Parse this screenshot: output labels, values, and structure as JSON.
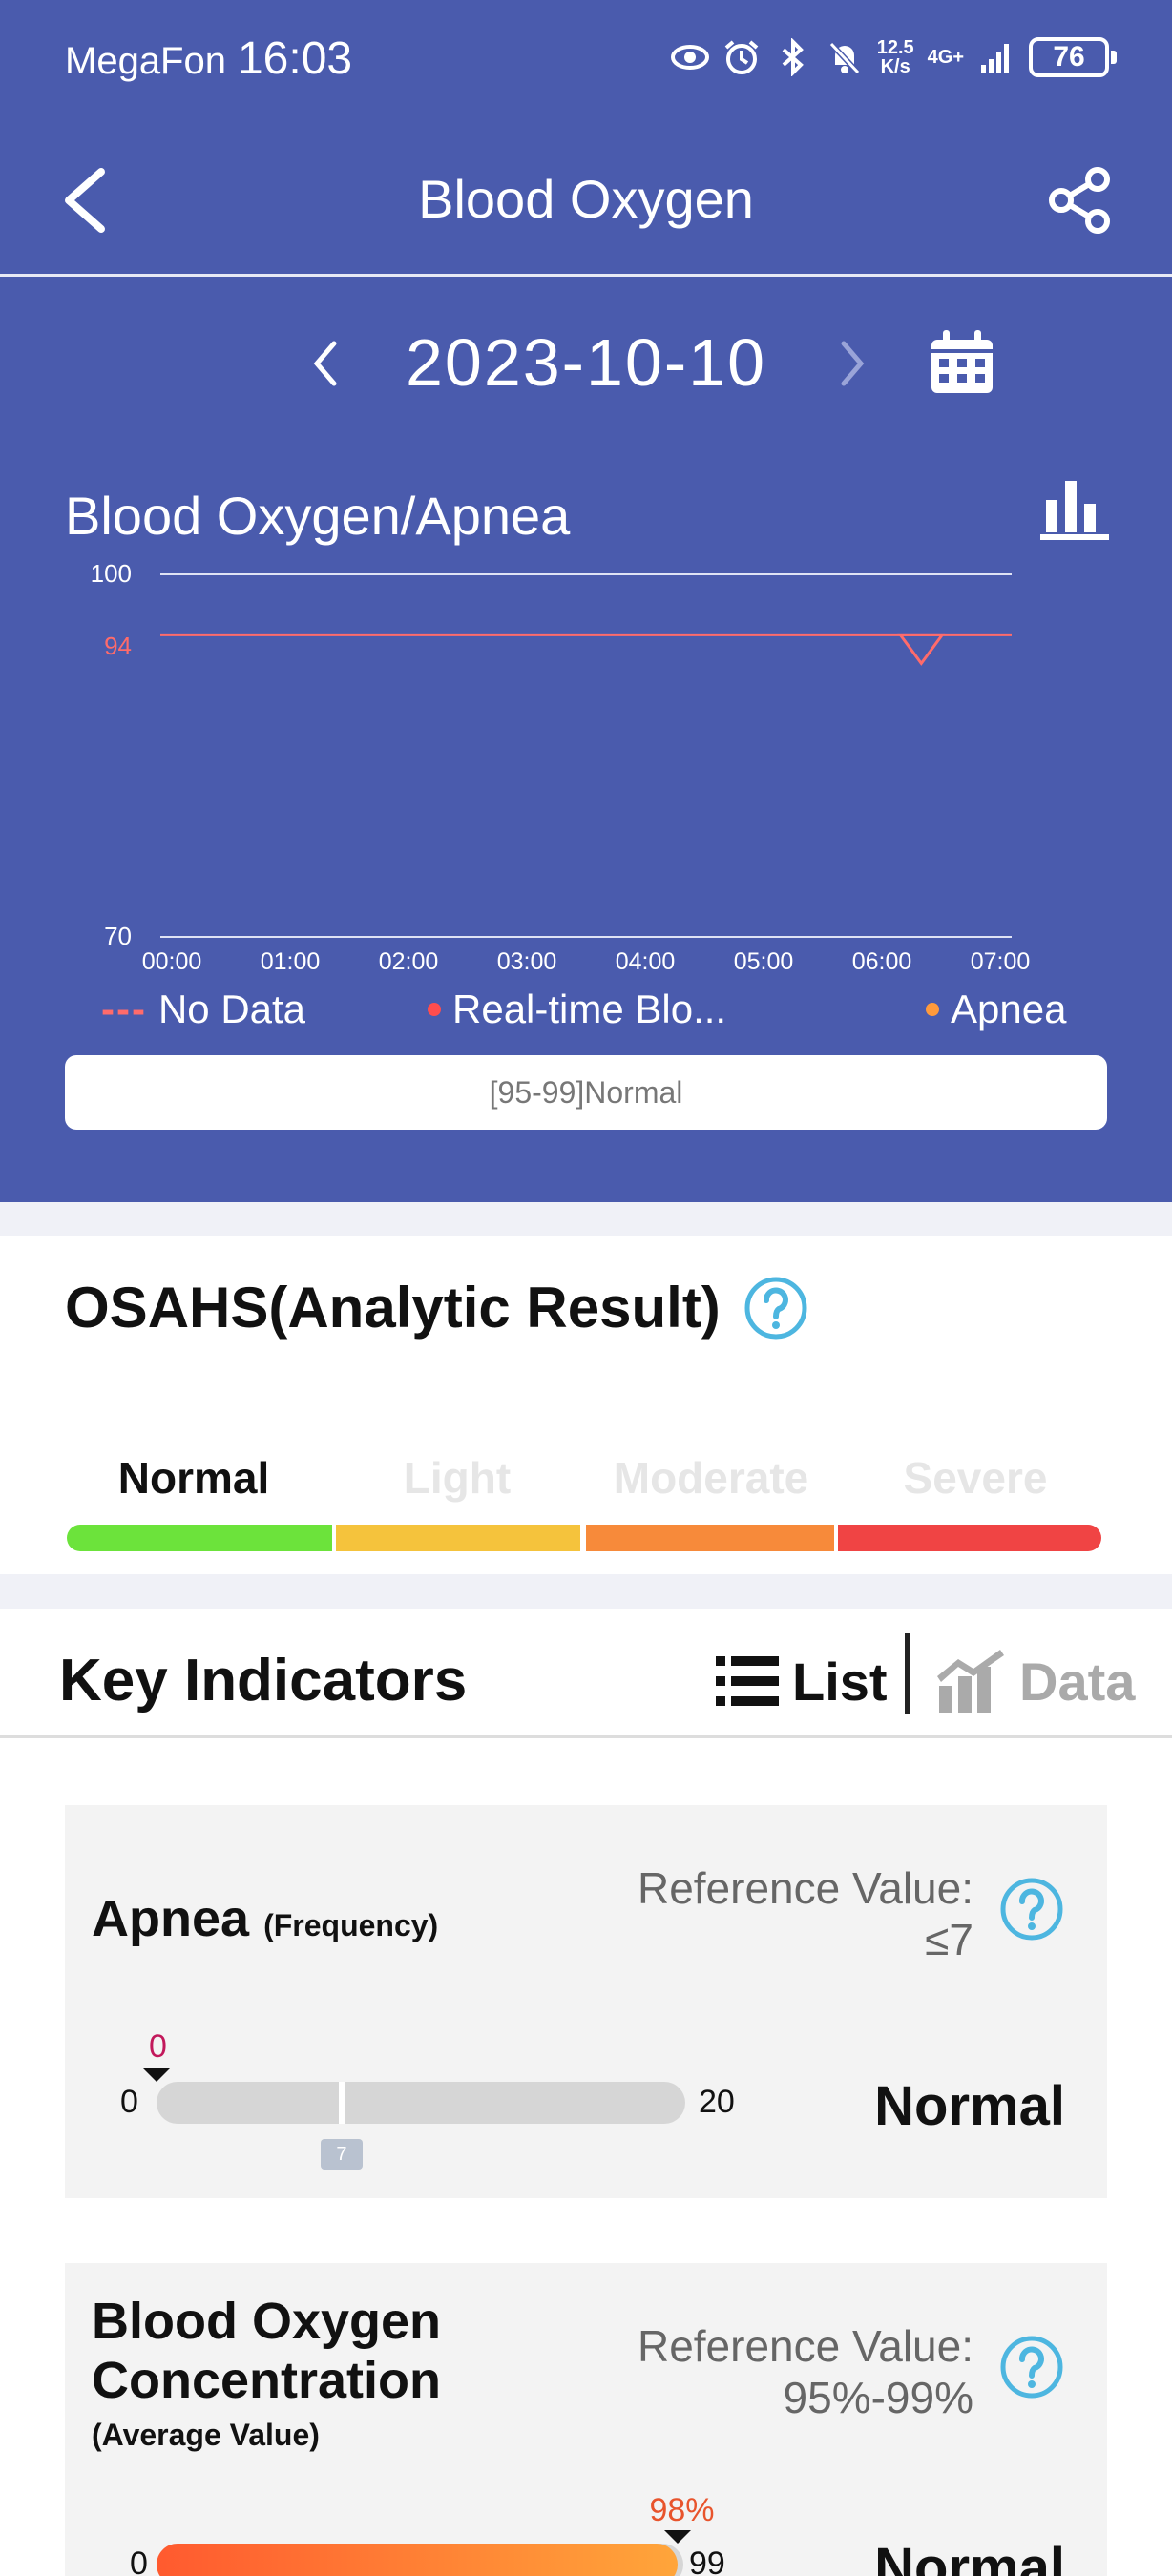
{
  "status_bar": {
    "carrier": "MegaFon",
    "time": "16:03",
    "net_speed_top": "12.5",
    "net_speed_bottom": "K/s",
    "network": "4G+",
    "battery": "76"
  },
  "nav": {
    "title": "Blood Oxygen"
  },
  "date": {
    "value": "2023-10-10"
  },
  "chart": {
    "title": "Blood Oxygen/Apnea",
    "legend": {
      "no_data_mark": "---",
      "no_data": "No Data",
      "realtime": "Real-time Blo...",
      "apnea": "Apnea"
    },
    "range_text": "[95-99]Normal"
  },
  "chart_data": {
    "type": "line",
    "x": [
      "00:00",
      "01:00",
      "02:00",
      "03:00",
      "04:00",
      "05:00",
      "06:00",
      "07:00"
    ],
    "y_ticks": [
      100,
      94,
      70
    ],
    "ylim": [
      70,
      100
    ],
    "reference_line": 95,
    "apnea_marker_time": "06:20",
    "series": [],
    "grid": false,
    "colors": {
      "reference": "#ff6b6b",
      "apnea": "#ff9a3c",
      "realtime": "#ff4d4d",
      "axis": "#dfe3f5"
    }
  },
  "osahs": {
    "title": "OSAHS(Analytic Result)",
    "levels": [
      {
        "label": "Normal",
        "color": "#6ce33b",
        "active": true
      },
      {
        "label": "Light",
        "color": "#f5c33c",
        "active": false
      },
      {
        "label": "Moderate",
        "color": "#f78a3a",
        "active": false
      },
      {
        "label": "Severe",
        "color": "#f04444",
        "active": false
      }
    ]
  },
  "indicators": {
    "title": "Key Indicators",
    "tab_list": "List",
    "tab_data": "Data",
    "apnea": {
      "name": "Apnea",
      "unit": "(Frequency)",
      "ref_label": "Reference Value:",
      "ref_value": "≤7",
      "min": "0",
      "max": "20",
      "value": "0",
      "value_fraction": 0,
      "ref_fraction": 0.35,
      "ref_tag": "7",
      "status": "Normal"
    },
    "spo2": {
      "name_line1": "Blood Oxygen",
      "name_line2": "Concentration",
      "sub": "(Average Value)",
      "ref_label": "Reference Value:",
      "ref_value": "95%-99%",
      "min": "0",
      "max": "99",
      "value": "98%",
      "value_fraction": 0.99,
      "status": "Normal"
    }
  }
}
